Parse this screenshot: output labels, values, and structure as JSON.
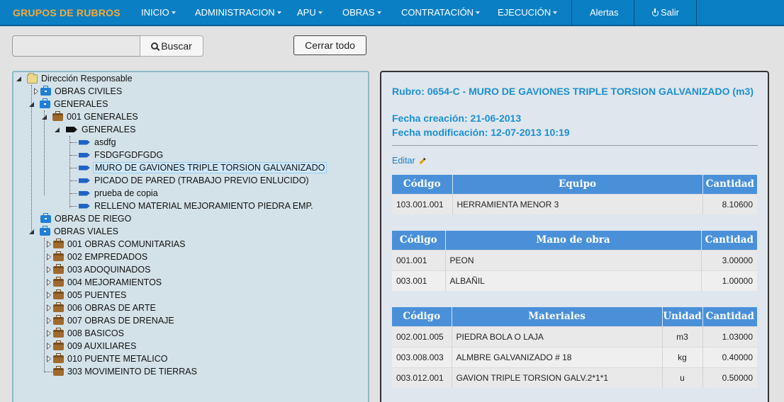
{
  "navbar": {
    "brand": "GRUPOS DE RUBROS",
    "menus": [
      "INICIO",
      "ADMINISTRACION",
      "APU",
      "OBRAS",
      "CONTRATACIÓN",
      "EJECUCIÓN"
    ],
    "alerts": "Alertas",
    "logout": "Salir"
  },
  "search": {
    "value": "",
    "button_label": "Buscar"
  },
  "close_all_label": "Cerrar todo",
  "tree": {
    "root": "Dirección Responsable",
    "nodes": [
      "OBRAS CIVILES",
      "GENERALES",
      "001 GENERALES",
      "GENERALES",
      "asdfg",
      "FSDGFGDFGDG",
      "MURO DE GAVIONES TRIPLE TORSION GALVANIZADO",
      "PICADO DE PARED (TRABAJO PREVIO ENLUCIDO)",
      "prueba de copia",
      "RELLENO MATERIAL MEJORAMIENTO PIEDRA EMP.",
      "OBRAS DE RIEGO",
      "OBRAS VIALES",
      "001 OBRAS COMUNITARIAS",
      "002 EMPREDADOS",
      "003 ADOQUINADOS",
      "004 MEJORAMIENTOS",
      "005 PUENTES",
      "006 OBRAS DE ARTE",
      "007 OBRAS DE DRENAJE",
      "008 BASICOS",
      "009 AUXILIARES",
      "010 PUENTE METALICO",
      "303 MOVIMEINTO DE TIERRAS"
    ],
    "selected": "MURO DE GAVIONES TRIPLE TORSION GALVANIZADO"
  },
  "detail": {
    "title": "Rubro: 0654-C - MURO DE GAVIONES TRIPLE TORSION GALVANIZADO (m3)",
    "created": "Fecha creación: 21-06-2013",
    "modified": "Fecha modificación: 12-07-2013 10:19",
    "edit_label": "Editar",
    "equipo": {
      "headers": [
        "Código",
        "Equipo",
        "Cantidad"
      ],
      "rows": [
        [
          "103.001.001",
          "HERRAMIENTA MENOR 3",
          "8.10600"
        ]
      ]
    },
    "mano_obra": {
      "headers": [
        "Código",
        "Mano de obra",
        "Cantidad"
      ],
      "rows": [
        [
          "001.001",
          "PEON",
          "3.00000"
        ],
        [
          "003.001",
          "ALBAÑIL",
          "1.00000"
        ]
      ]
    },
    "materiales": {
      "headers": [
        "Código",
        "Materiales",
        "Unidad",
        "Cantidad"
      ],
      "rows": [
        [
          "002.001.005",
          "PIEDRA BOLA O LAJA",
          "m3",
          "1.03000"
        ],
        [
          "003.008.003",
          "ALMBRE GALVANIZADO # 18",
          "kg",
          "0.40000"
        ],
        [
          "003.012.001",
          "GAVION TRIPLE TORSION GALV.2*1*1",
          "u",
          "0.50000"
        ]
      ]
    }
  },
  "colors": {
    "navbar": "#0b7fc4",
    "brand": "#f2a93b",
    "title_blue": "#1b8fd0",
    "table_header": "#4a90d9",
    "tree_bg": "#d3e2e9"
  }
}
